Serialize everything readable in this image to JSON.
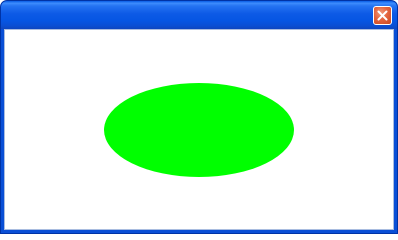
{
  "window": {
    "title": "",
    "frame_color": "#0a4fd6",
    "client_background": "#ffffff"
  },
  "titlebar": {
    "close_icon": "close-icon",
    "close_color": "#e4643e"
  },
  "content": {
    "shape": "ellipse",
    "fill": "#00ff00"
  }
}
